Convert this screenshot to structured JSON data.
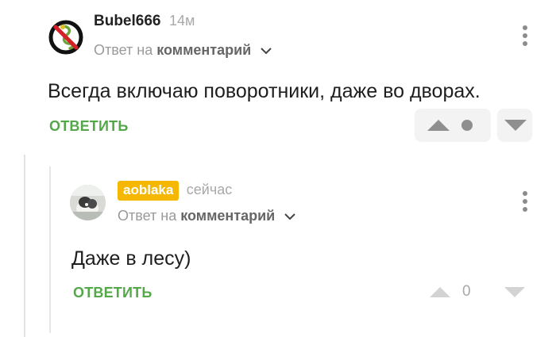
{
  "comments": [
    {
      "author": "Bubel666",
      "time": "14м",
      "reply_prefix": "Ответ на",
      "reply_target": "комментарий",
      "text": "Всегда включаю поворотники, даже во дворах.",
      "reply_label": "ОТВЕТИТЬ",
      "avatar_icon": "no-snake-sign-icon"
    },
    {
      "author": "aoblaka",
      "time": "сейчас",
      "reply_prefix": "Ответ на",
      "reply_target": "комментарий",
      "text": "Даже в лесу)",
      "reply_label": "ОТВЕТИТЬ",
      "score": "0",
      "avatar_icon": "dog-photo-avatar"
    }
  ],
  "colors": {
    "accent_green": "#54a84a",
    "highlight_badge": "#f5b700",
    "muted": "#a9a9a9"
  }
}
